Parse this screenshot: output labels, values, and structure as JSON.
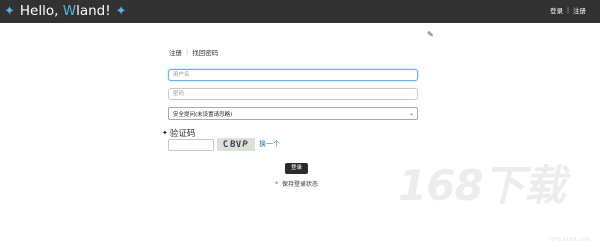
{
  "header": {
    "brand_prefix": "Hello, ",
    "brand_accent": "W",
    "brand_suffix": "land!",
    "left_icon": "sparkle-icon",
    "right_icon": "sparkle-icon",
    "links": [
      {
        "label": "登录"
      },
      {
        "label": "注册"
      }
    ],
    "separator": "|",
    "accent_color": "#5ab4de",
    "background": "#323232"
  },
  "edit_icon": "pencil-icon",
  "tabs": {
    "register": "注册",
    "separator": "|",
    "find_password": "找回密码"
  },
  "form": {
    "username_placeholder": "用户名",
    "password_placeholder": "密码",
    "security_question_selected": "安全提问(未设置请忽略)",
    "captcha_label": "验证码",
    "captcha_image_text": [
      "C",
      "B",
      "V",
      "P"
    ],
    "captcha_refresh": "换一个",
    "login_button": "登录",
    "remember_label": "保持登录状态"
  },
  "watermark": {
    "text": "168下载",
    "url": "QPS.it168.com"
  }
}
